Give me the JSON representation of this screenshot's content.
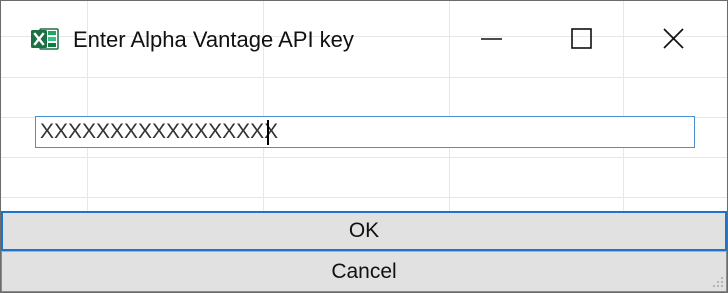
{
  "window": {
    "title": "Enter Alpha Vantage API key",
    "app_icon": "excel-icon",
    "controls": {
      "minimize_icon": "minimize-icon",
      "maximize_icon": "maximize-icon",
      "close_icon": "close-icon"
    }
  },
  "form": {
    "api_key_value": "XXXXXXXXXXXXXXXXX"
  },
  "buttons": {
    "ok_label": "OK",
    "cancel_label": "Cancel"
  },
  "colors": {
    "input_border": "#4a8fd3",
    "ok_border": "#1e74c8",
    "button_face": "#e1e1e1",
    "excel_green": "#1d7044"
  }
}
